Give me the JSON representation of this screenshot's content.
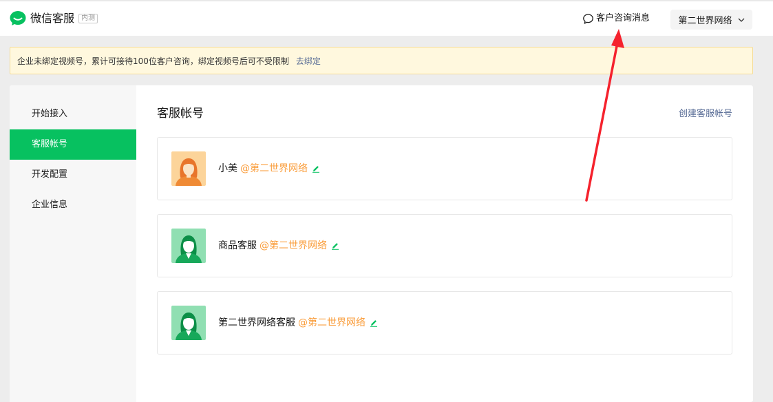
{
  "header": {
    "brand_title": "微信客服",
    "brand_badge": "内测",
    "message_link": "客户咨询消息",
    "account_name": "第二世界网络"
  },
  "notice": {
    "text": "企业未绑定视频号，累计可接待100位客户咨询，绑定视频号后可不受限制",
    "link": "去绑定"
  },
  "sidebar": {
    "items": [
      {
        "label": "开始接入",
        "active": false
      },
      {
        "label": "客服帐号",
        "active": true
      },
      {
        "label": "开发配置",
        "active": false
      },
      {
        "label": "企业信息",
        "active": false
      }
    ]
  },
  "content": {
    "title": "客服帐号",
    "create_link": "创建客服帐号"
  },
  "accounts": [
    {
      "name": "小美",
      "owner": "@第二世界网络",
      "avatar": "female-avatar-orange"
    },
    {
      "name": "商品客服",
      "owner": "@第二世界网络",
      "avatar": "female-avatar-green"
    },
    {
      "name": "第二世界网络客服",
      "owner": "@第二世界网络",
      "avatar": "female-avatar-green"
    }
  ],
  "colors": {
    "brand_green": "#07c160",
    "owner_orange": "#fa9d3b",
    "link_blue": "#576b95",
    "annotation_red": "#f5222d"
  }
}
